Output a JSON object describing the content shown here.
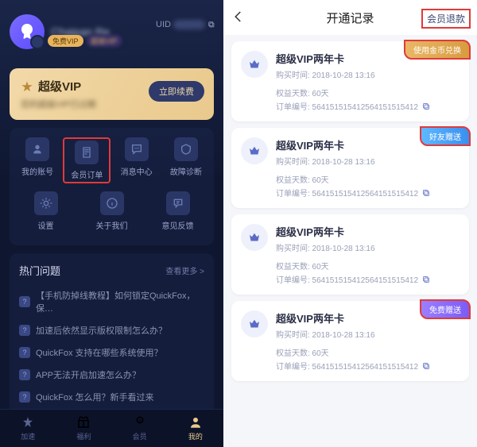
{
  "left": {
    "username_blur": "Chaipan Re",
    "badges": {
      "vip": "免费VIP",
      "extra": "超级VIP"
    },
    "uid_label": "UID",
    "vip_card": {
      "title": "超级VIP",
      "subtitle_prefix": "您的超级VIP已过期",
      "renew_btn": "立即续费"
    },
    "grid_row1": [
      {
        "label": "我的账号",
        "icon": "user-icon"
      },
      {
        "label": "会员订单",
        "icon": "order-icon"
      },
      {
        "label": "消息中心",
        "icon": "message-icon"
      },
      {
        "label": "故障诊断",
        "icon": "diagnose-icon"
      }
    ],
    "grid_row2": [
      {
        "label": "设置",
        "icon": "settings-icon"
      },
      {
        "label": "关于我们",
        "icon": "about-icon"
      },
      {
        "label": "意见反馈",
        "icon": "feedback-icon"
      }
    ],
    "faq": {
      "title": "热门问题",
      "more": "查看更多 >",
      "items": [
        "【手机防掉线教程】如何锁定QuickFox，保…",
        "加速后依然显示版权限制怎么办？",
        "QuickFox 支持在哪些系统使用？",
        "APP无法开启加速怎么办？",
        "QuickFox 怎么用？新手看过来"
      ]
    },
    "nav": [
      {
        "label": "加速",
        "icon": "speed-icon"
      },
      {
        "label": "福利",
        "icon": "gift-icon"
      },
      {
        "label": "会员",
        "icon": "member-icon"
      },
      {
        "label": "我的",
        "icon": "me-icon"
      }
    ]
  },
  "right": {
    "title": "开通记录",
    "refund": "会员退款",
    "records": [
      {
        "tag": "使用金币兑换",
        "tag_style": "gold",
        "title": "超级VIP两年卡",
        "purchase_label": "购买时间:",
        "purchase_time": "2018-10-28 13:16",
        "days_label": "权益天数:",
        "days": "60天",
        "order_label": "订单编号:",
        "order_no": "56415151541256415151541"
      },
      {
        "tag": "好友赠送",
        "tag_style": "blue",
        "title": "超级VIP两年卡",
        "purchase_label": "购买时间:",
        "purchase_time": "2018-10-28 13:16",
        "days_label": "权益天数:",
        "days": "60天",
        "order_label": "订单编号:",
        "order_no": "56415151541256415151541"
      },
      {
        "tag": "",
        "tag_style": "",
        "title": "超级VIP两年卡",
        "purchase_label": "购买时间:",
        "purchase_time": "2018-10-28 13:16",
        "days_label": "权益天数:",
        "days": "60天",
        "order_label": "订单编号:",
        "order_no": "56415151541256415151541"
      },
      {
        "tag": "免费赠送",
        "tag_style": "purple",
        "title": "超级VIP两年卡",
        "purchase_label": "购买时间:",
        "purchase_time": "2018-10-28 13:16",
        "days_label": "权益天数:",
        "days": "60天",
        "order_label": "订单编号:",
        "order_no": "56415151541256415151541"
      }
    ]
  }
}
